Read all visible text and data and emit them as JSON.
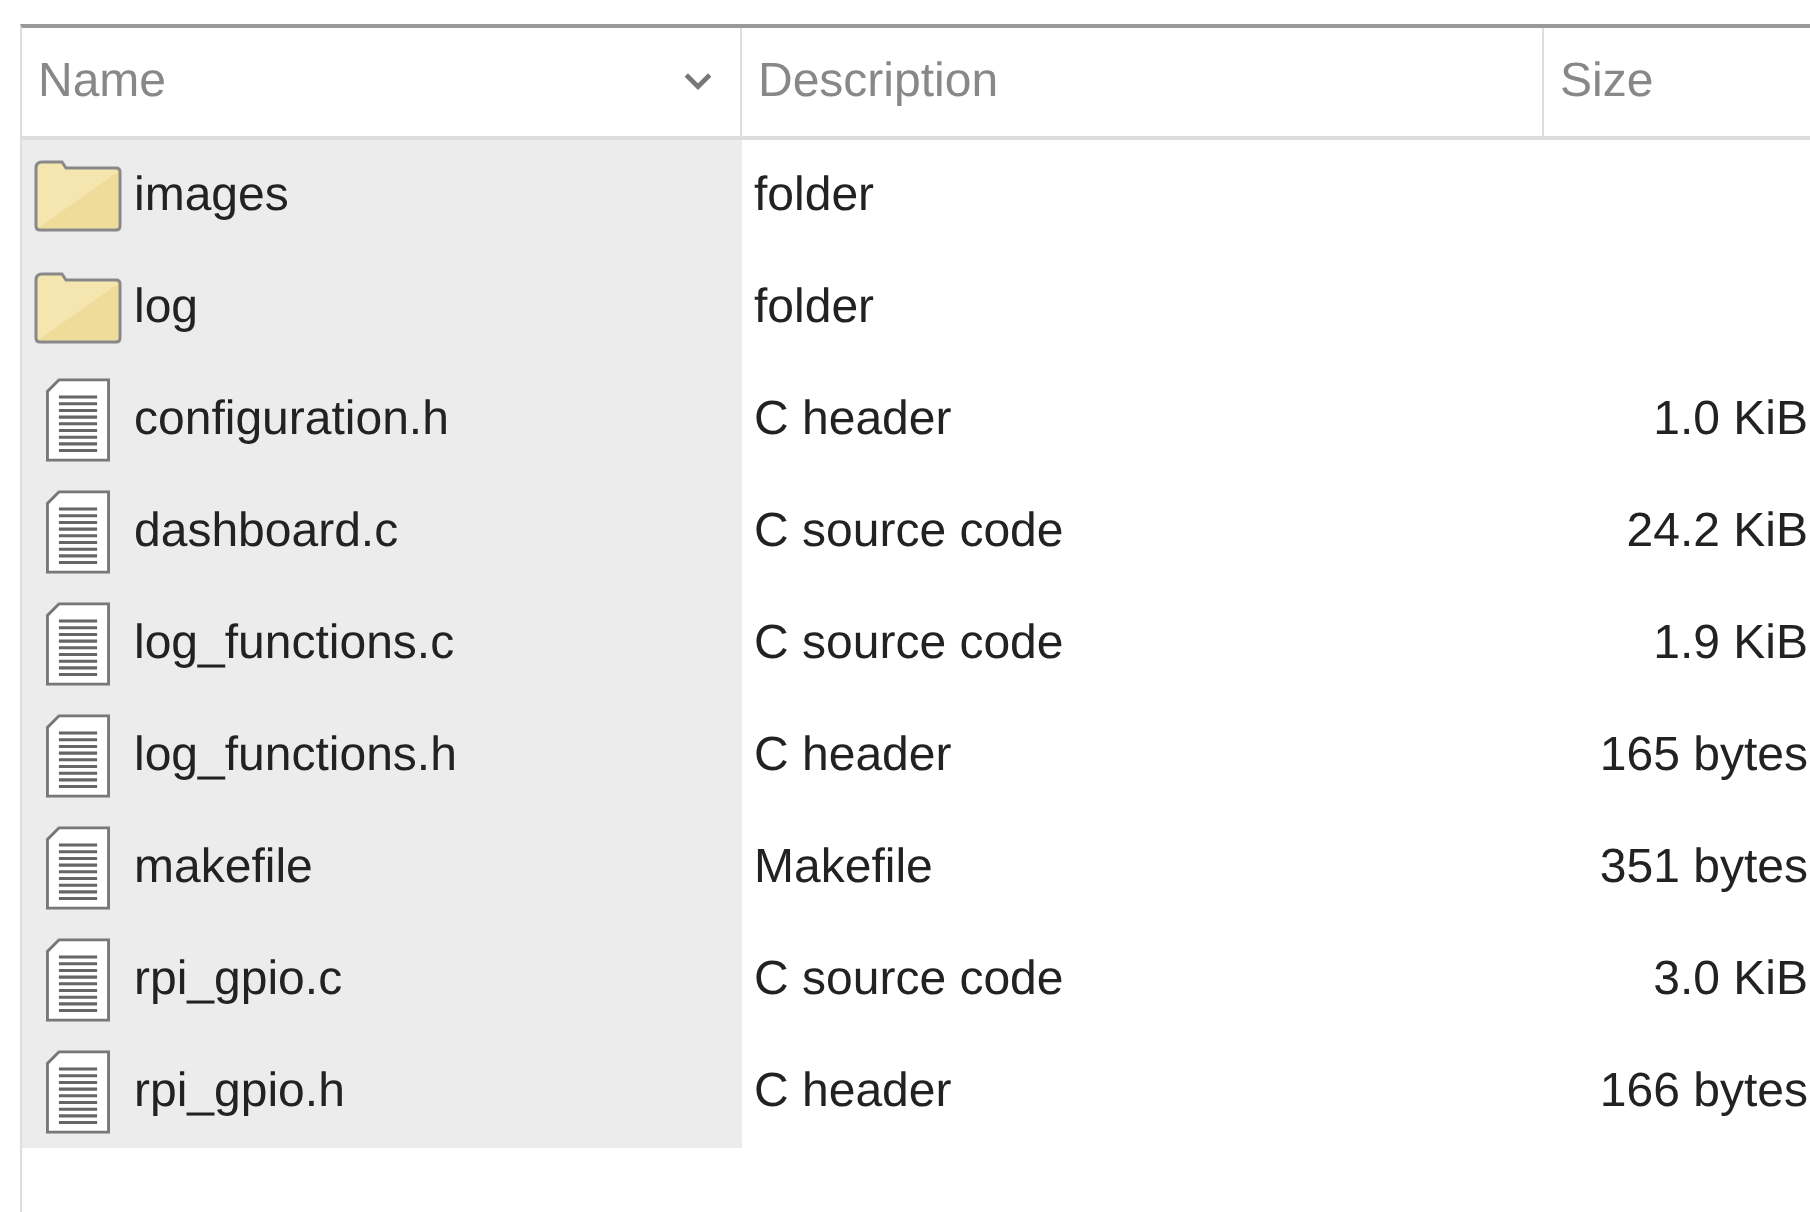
{
  "table": {
    "columns": [
      {
        "label": "Name",
        "sorted": true
      },
      {
        "label": "Description",
        "sorted": false
      },
      {
        "label": "Size",
        "sorted": false
      }
    ],
    "rows": [
      {
        "kind": "folder",
        "name": "images",
        "description": "folder"
      },
      {
        "kind": "folder",
        "name": "log",
        "description": "folder"
      },
      {
        "kind": "file",
        "name": "configuration.h",
        "description": "C header",
        "size": "1.0 KiB"
      },
      {
        "kind": "file",
        "name": "dashboard.c",
        "description": "C source code",
        "size": "24.2 KiB"
      },
      {
        "kind": "file",
        "name": "log_functions.c",
        "description": "C source code",
        "size": "1.9 KiB"
      },
      {
        "kind": "file",
        "name": "log_functions.h",
        "description": "C header",
        "size": "165 bytes"
      },
      {
        "kind": "file",
        "name": "makefile",
        "description": "Makefile",
        "size": "351 bytes"
      },
      {
        "kind": "file",
        "name": "rpi_gpio.c",
        "description": "C source code",
        "size": "3.0 KiB"
      },
      {
        "kind": "file",
        "name": "rpi_gpio.h",
        "description": "C header",
        "size": "166 bytes"
      }
    ]
  }
}
